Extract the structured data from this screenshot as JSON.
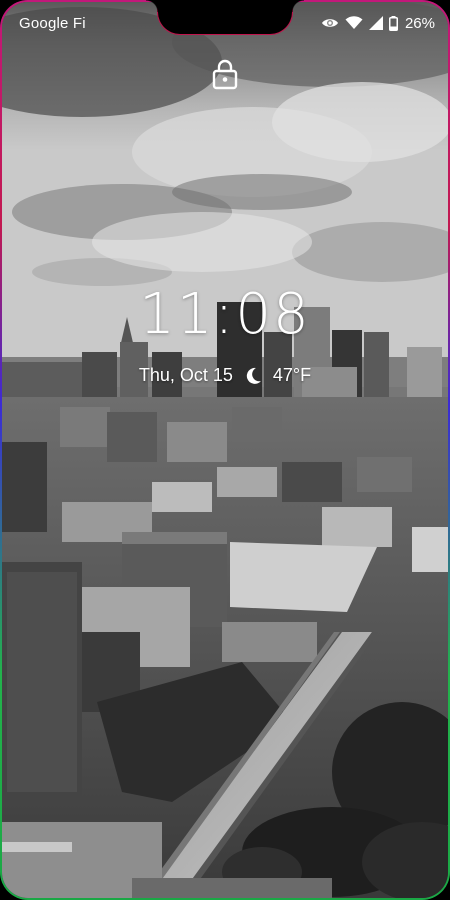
{
  "status_bar": {
    "carrier": "Google Fi",
    "battery_percent": "26%",
    "icons": [
      "eye-icon",
      "wifi-icon",
      "cellular-signal-icon",
      "battery-icon"
    ]
  },
  "lock_screen": {
    "lock_icon": "lock-icon",
    "time": "11:08",
    "date": "Thu, Oct 15",
    "weather_icon": "moon-icon",
    "temperature": "47°F"
  },
  "colors": {
    "text": "#ffffff",
    "notch_edge": "#c0144c",
    "edge_top": "#c2187a",
    "edge_left_mid": "#3b2bd6",
    "edge_bottom": "#1aa845"
  },
  "wallpaper": {
    "description_icon": "city-skyline-wallpaper",
    "style": "grayscale"
  }
}
